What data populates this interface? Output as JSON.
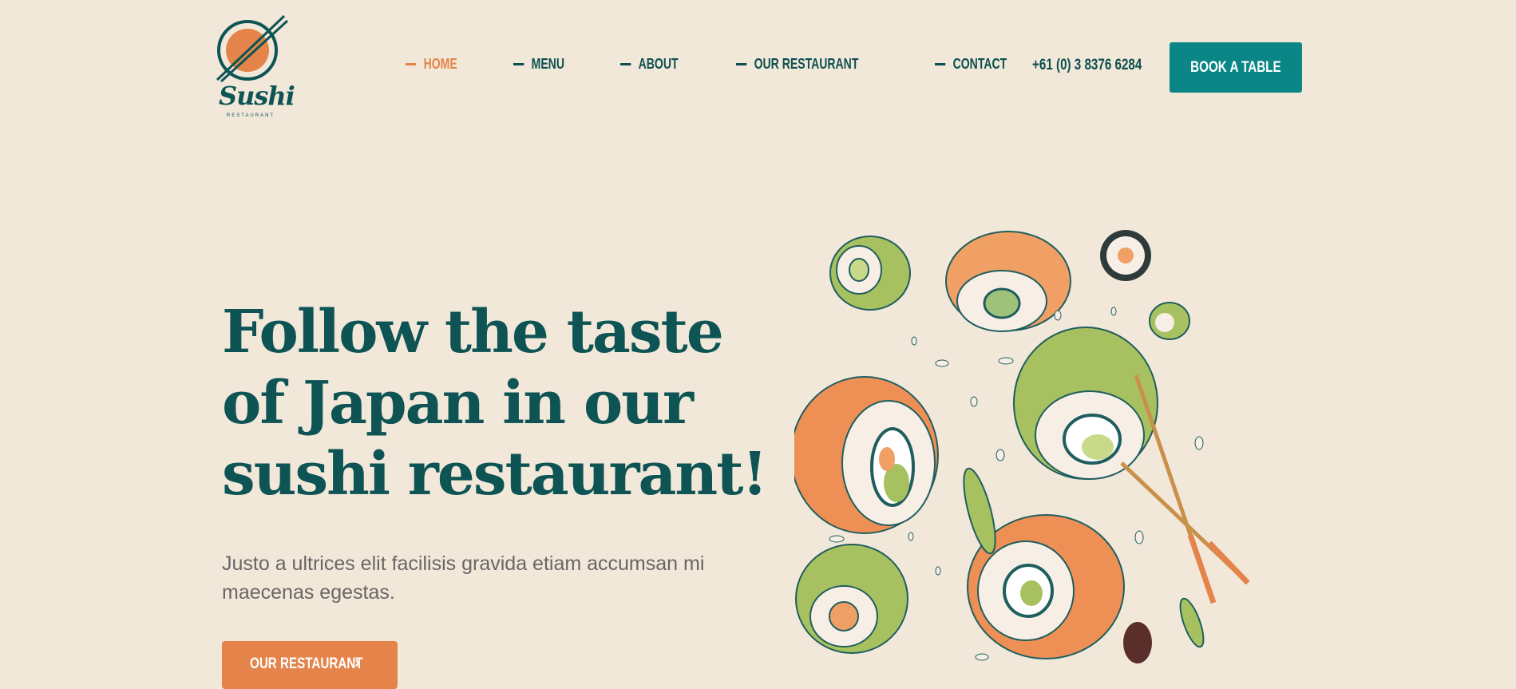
{
  "brand": {
    "name": "Sushi",
    "subtitle": "RESTAURANT"
  },
  "nav": {
    "items": [
      {
        "label": "HOME",
        "active": true
      },
      {
        "label": "MENU",
        "active": false
      },
      {
        "label": "ABOUT",
        "active": false
      },
      {
        "label": "OUR RESTAURANT",
        "active": false
      },
      {
        "label": "CONTACT",
        "active": false
      }
    ]
  },
  "header": {
    "phone": "+61 (0) 3 8376 6284",
    "book_label": "BOOK A TABLE"
  },
  "hero": {
    "title_lines": [
      "Follow the taste",
      "of Japan in our",
      "sushi restaurant!"
    ],
    "text": "Justo a ultrices elit facilisis gravida etiam accumsan mi maecenas egestas.",
    "cta_label": "OUR RESTAURANT",
    "image": "sushi-rolls-illustration"
  },
  "colors": {
    "background": "#f2e8da",
    "teal_dark": "#0d4f4f",
    "teal_button": "#0b8686",
    "orange": "#e4844a",
    "body_text": "#6a6666"
  }
}
